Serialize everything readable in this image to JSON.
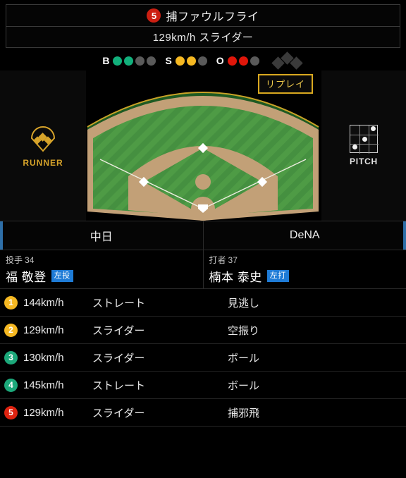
{
  "result": {
    "badge_number": "5",
    "badge_color": "#CC1F12",
    "outcome": "捕ファウルフライ",
    "pitch_detail": "129km/h スライダー"
  },
  "count": {
    "ball_label": "B",
    "balls": 2,
    "ball_slots": 4,
    "ball_color": "#12B07C",
    "strike_label": "S",
    "strikes": 2,
    "strike_slots": 3,
    "strike_color": "#F5B822",
    "out_label": "O",
    "outs": 2,
    "out_slots": 3,
    "out_color": "#E0160A",
    "bases_occupied": [
      false,
      false,
      false
    ]
  },
  "field": {
    "replay_label": "リプレイ",
    "replay_border_color": "#D9A81F",
    "runner_label": "RUNNER",
    "runner_color": "#D6A32A",
    "pitch_label": "PITCH"
  },
  "teams": {
    "away": "中日",
    "home": "DeNA",
    "accent_color": "#2E6FA8"
  },
  "pitcher": {
    "role": "投手",
    "number": "34",
    "name": "福 敬登",
    "hand": "左投",
    "hand_color": "#1E7BD6"
  },
  "batter": {
    "role": "打者",
    "number": "37",
    "name": "楠本 泰史",
    "hand": "左打",
    "hand_color": "#1E7BD6"
  },
  "pitch_list": {
    "rows": [
      {
        "num": "1",
        "kind": "strike",
        "speed": "144km/h",
        "type": "ストレート",
        "result": "見逃し"
      },
      {
        "num": "2",
        "kind": "strike",
        "speed": "129km/h",
        "type": "スライダー",
        "result": "空振り"
      },
      {
        "num": "3",
        "kind": "ball",
        "speed": "130km/h",
        "type": "スライダー",
        "result": "ボール"
      },
      {
        "num": "4",
        "kind": "ball",
        "speed": "145km/h",
        "type": "ストレート",
        "result": "ボール"
      },
      {
        "num": "5",
        "kind": "out",
        "speed": "129km/h",
        "type": "スライダー",
        "result": "捕邪飛"
      }
    ]
  }
}
